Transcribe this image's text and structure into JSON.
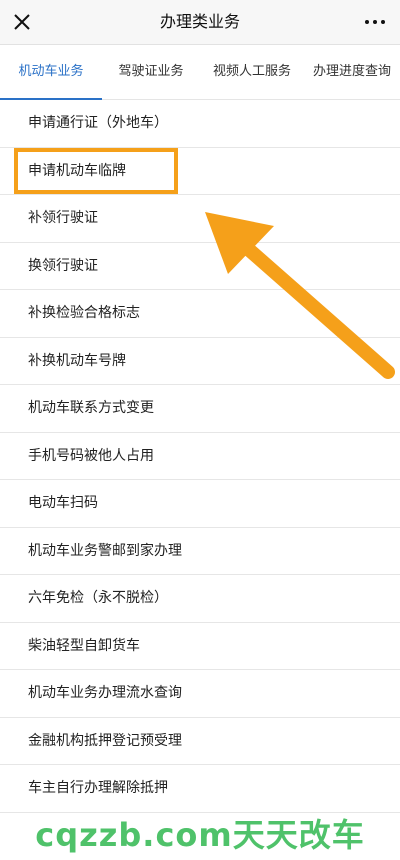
{
  "header": {
    "title": "办理类业务",
    "close_icon": "close-icon",
    "more_icon": "more-dots-icon"
  },
  "tabs": [
    {
      "label": "机动车业务",
      "active": true
    },
    {
      "label": "驾驶证业务",
      "active": false
    },
    {
      "label": "视频人工服务",
      "active": false
    },
    {
      "label": "办理进度查询",
      "active": false
    }
  ],
  "list": [
    "申请通行证（外地车）",
    "申请机动车临牌",
    "补领行驶证",
    "换领行驶证",
    "补换检验合格标志",
    "补换机动车号牌",
    "机动车联系方式变更",
    "手机号码被他人占用",
    "电动车扫码",
    "机动车业务警邮到家办理",
    "六年免检（永不脱检）",
    "柴油轻型自卸货车",
    "机动车业务办理流水查询",
    "金融机构抵押登记预受理",
    "车主自行办理解除抵押"
  ],
  "annotation": {
    "highlighted_item": "申请机动车临牌",
    "color": "#f5a01a"
  },
  "watermark": "cqzzb.com天天改车",
  "colors": {
    "accent": "#2a71c7",
    "annotation": "#f5a01a",
    "watermark": "#4fc26a"
  }
}
